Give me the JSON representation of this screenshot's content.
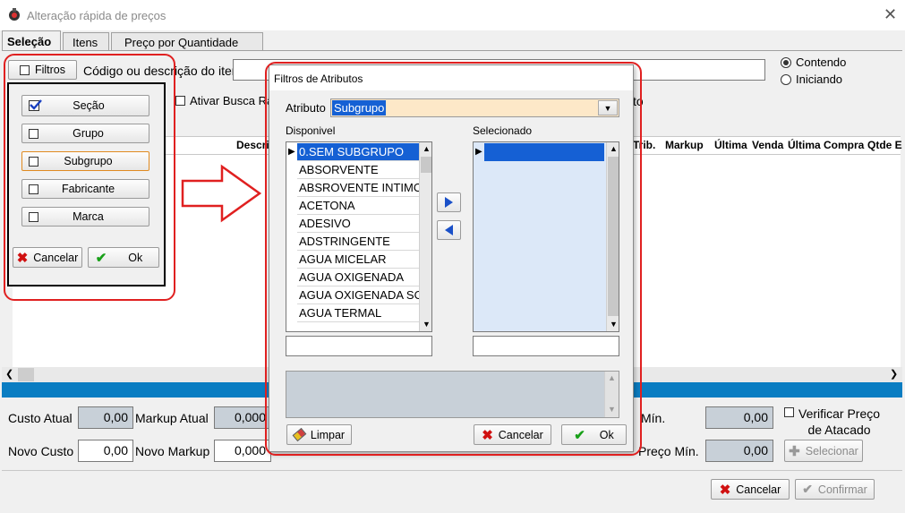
{
  "window": {
    "title": "Alteração rápida de preços"
  },
  "tabs": [
    "Seleção",
    "Itens",
    "Preço por Quantidade"
  ],
  "filter_panel": {
    "toggle_label": "Filtros",
    "options": [
      {
        "label": "Seção",
        "checked": true
      },
      {
        "label": "Grupo",
        "checked": false
      },
      {
        "label": "Subgrupo",
        "checked": false
      },
      {
        "label": "Fabricante",
        "checked": false
      },
      {
        "label": "Marca",
        "checked": false
      }
    ],
    "cancel_label": "Cancelar",
    "ok_label": "Ok"
  },
  "search": {
    "label": "Código ou descrição do item",
    "value": "",
    "mode_options": [
      "Contendo",
      "Iniciando"
    ],
    "selected_mode": "Contendo",
    "ativar_label": "Ativar Busca Ra",
    "right_fragment": "to"
  },
  "columns": [
    "Descri",
    "Trib.",
    "Markup",
    "Última",
    "Venda",
    "Última Compra",
    "Qtde E"
  ],
  "bottom": {
    "custo_atual_label": "Custo Atual",
    "custo_atual": "0,00",
    "markup_atual_label": "Markup Atual",
    "markup_atual": "0,000",
    "min_label": "Mín.",
    "min_value": "0,00",
    "novo_custo_label": "Novo Custo",
    "novo_custo": "0,00",
    "novo_markup_label": "Novo Markup",
    "novo_markup": "0,000",
    "preco_min_label": "Preço Mín.",
    "preco_min": "0,00",
    "verificar_label_1": "Verificar Preço",
    "verificar_label_2": "de Atacado",
    "selecionar_label": "Selecionar"
  },
  "footer": {
    "cancel_label": "Cancelar",
    "confirm_label": "Confirmar"
  },
  "dialog": {
    "title": "Filtros de Atributos",
    "atributo_label": "Atributo",
    "atributo_value": "Subgrupo",
    "disponivel_label": "Disponivel",
    "selecionado_label": "Selecionado",
    "items": [
      "0.SEM SUBGRUPO",
      "ABSORVENTE",
      "ABSROVENTE INTIMO",
      "ACETONA",
      "ADESIVO",
      "ADSTRINGENTE",
      "AGUA MICELAR",
      "AGUA OXIGENADA",
      "AGUA OXIGENADA SO",
      "AGUA TERMAL"
    ],
    "limpar_label": "Limpar",
    "cancel_label": "Cancelar",
    "ok_label": "Ok"
  },
  "colors": {
    "accent_blue": "#0a7dc2",
    "selection": "#1560d4",
    "annotation_red": "#e02020"
  }
}
